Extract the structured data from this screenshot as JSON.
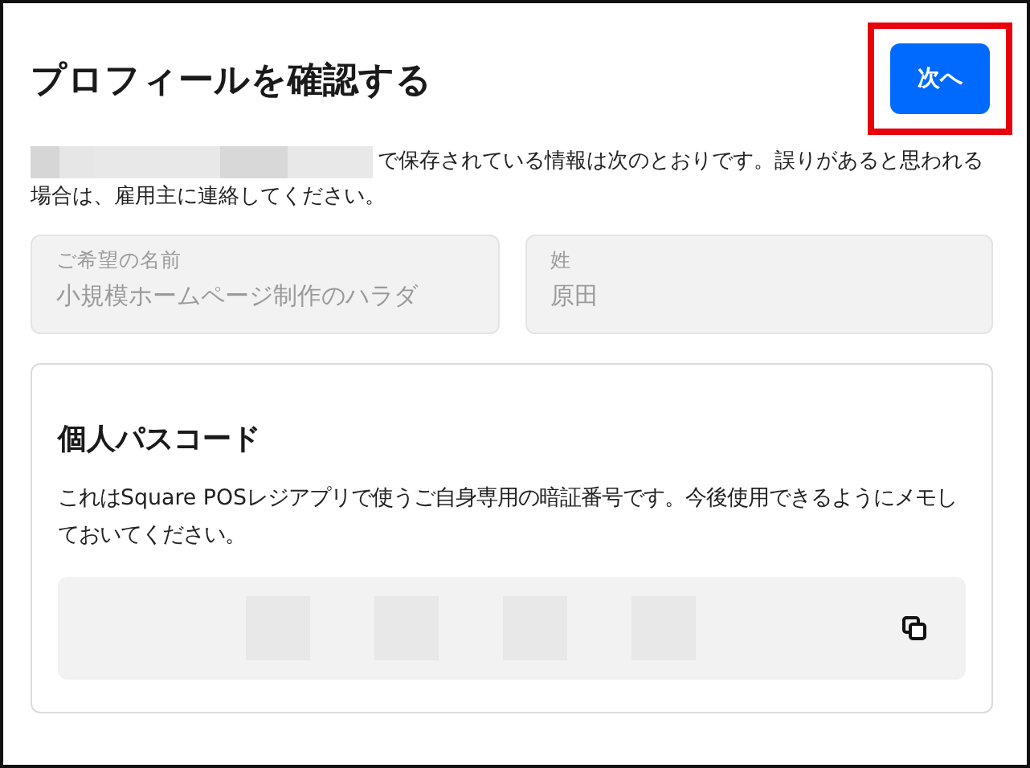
{
  "header": {
    "title": "プロフィールを確認する",
    "next_button": {
      "label": "次へ",
      "highlighted": true
    }
  },
  "intro": "で保存されている情報は次のとおりです。誤りがあると思われる場合は、雇用主に連絡してください。",
  "fields": [
    {
      "label": "ご希望の名前",
      "value": "小規模ホームページ制作のハラダ",
      "disabled": true
    },
    {
      "label": "姓",
      "value": "原田",
      "disabled": true
    }
  ],
  "passcode_card": {
    "title": "個人パスコード",
    "description": "これはSquare POSレジアプリで使うご自身専用の暗証番号です。今後使用できるようにメモしておいてください。"
  }
}
